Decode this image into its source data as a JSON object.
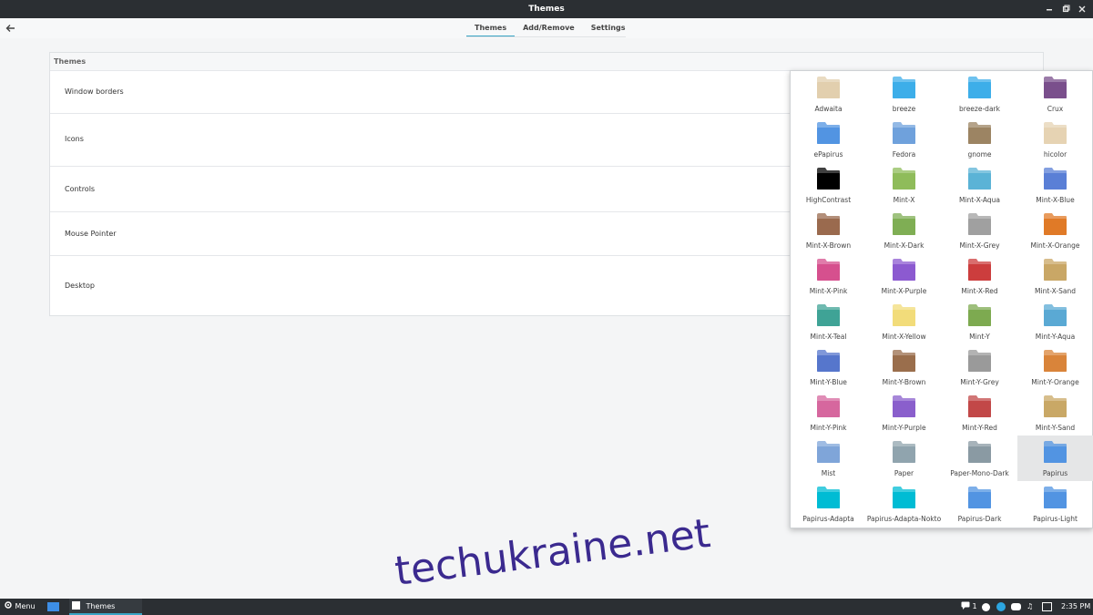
{
  "window": {
    "title": "Themes"
  },
  "tabs": [
    {
      "label": "Themes",
      "active": true
    },
    {
      "label": "Add/Remove",
      "active": false
    },
    {
      "label": "Settings",
      "active": false
    }
  ],
  "panel": {
    "header": "Themes",
    "rows": [
      "Window borders",
      "Icons",
      "Controls",
      "Mouse Pointer",
      "Desktop"
    ]
  },
  "icon_themes": [
    {
      "label": "Adwaita",
      "color": "#e2cfae"
    },
    {
      "label": "breeze",
      "color": "#3daee9"
    },
    {
      "label": "breeze-dark",
      "color": "#3daee9"
    },
    {
      "label": "Crux",
      "color": "#7a4f8c"
    },
    {
      "label": "ePapirus",
      "color": "#5294e2"
    },
    {
      "label": "Fedora",
      "color": "#6fa1dc"
    },
    {
      "label": "gnome",
      "color": "#9c8463"
    },
    {
      "label": "hicolor",
      "color": "#e6d3b3"
    },
    {
      "label": "HighContrast",
      "color": "#000000"
    },
    {
      "label": "Mint-X",
      "color": "#8fbc5a"
    },
    {
      "label": "Mint-X-Aqua",
      "color": "#5bb3d6"
    },
    {
      "label": "Mint-X-Blue",
      "color": "#5a7fd6"
    },
    {
      "label": "Mint-X-Brown",
      "color": "#9a6a4e"
    },
    {
      "label": "Mint-X-Dark",
      "color": "#7fae54"
    },
    {
      "label": "Mint-X-Grey",
      "color": "#a0a0a0"
    },
    {
      "label": "Mint-X-Orange",
      "color": "#e07a27"
    },
    {
      "label": "Mint-X-Pink",
      "color": "#d6508e"
    },
    {
      "label": "Mint-X-Purple",
      "color": "#8c5ad0"
    },
    {
      "label": "Mint-X-Red",
      "color": "#cc3d3d"
    },
    {
      "label": "Mint-X-Sand",
      "color": "#c9a766"
    },
    {
      "label": "Mint-X-Teal",
      "color": "#3fa396"
    },
    {
      "label": "Mint-X-Yellow",
      "color": "#f2dc7a"
    },
    {
      "label": "Mint-Y",
      "color": "#7daa50"
    },
    {
      "label": "Mint-Y-Aqua",
      "color": "#5aa9d4"
    },
    {
      "label": "Mint-Y-Blue",
      "color": "#5676cc"
    },
    {
      "label": "Mint-Y-Brown",
      "color": "#9a6e4c"
    },
    {
      "label": "Mint-Y-Grey",
      "color": "#9a9a9a"
    },
    {
      "label": "Mint-Y-Orange",
      "color": "#d9843a"
    },
    {
      "label": "Mint-Y-Pink",
      "color": "#d6679e"
    },
    {
      "label": "Mint-Y-Purple",
      "color": "#8a5fcc"
    },
    {
      "label": "Mint-Y-Red",
      "color": "#c24848"
    },
    {
      "label": "Mint-Y-Sand",
      "color": "#c9a866"
    },
    {
      "label": "Mist",
      "color": "#7fa5d9"
    },
    {
      "label": "Paper",
      "color": "#90a4ae"
    },
    {
      "label": "Paper-Mono-Dark",
      "color": "#8a9aa3"
    },
    {
      "label": "Papirus",
      "color": "#5294e2",
      "selected": true
    },
    {
      "label": "Papirus-Adapta",
      "color": "#00bcd4"
    },
    {
      "label": "Papirus-Adapta-Nokto",
      "color": "#00bcd4"
    },
    {
      "label": "Papirus-Dark",
      "color": "#5294e2"
    },
    {
      "label": "Papirus-Light",
      "color": "#5294e2"
    }
  ],
  "taskbar": {
    "menu_label": "Menu",
    "task_label": "Themes",
    "notification_count": "1",
    "clock": "2:35 PM"
  },
  "watermark": "techukraine.net",
  "colors": {
    "accent": "#3aa5c6",
    "titlebar": "#2b2f33"
  }
}
